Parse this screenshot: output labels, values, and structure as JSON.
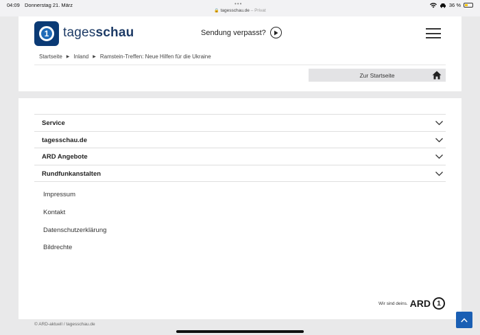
{
  "status_bar": {
    "time": "04:09",
    "date": "Donnerstag 21. März",
    "dots": "•••",
    "url": "tagesschau.de",
    "url_suffix": "– Privat",
    "battery": "36 %",
    "battery_level": 0.36
  },
  "header": {
    "brand_light": "tages",
    "brand_bold": "schau",
    "sendung_label": "Sendung verpasst?",
    "breadcrumbs": [
      "Startseite",
      "Inland",
      "Ramstein-Treffen: Neue Hilfen für die Ukraine"
    ],
    "home_button": "Zur Startseite"
  },
  "footer": {
    "accordion": [
      "Service",
      "tagesschau.de",
      "ARD Angebote",
      "Rundfunkanstalten"
    ],
    "links": [
      "Impressum",
      "Kontakt",
      "Datenschutzerklärung",
      "Bildrechte"
    ],
    "ard_tagline": "Wir sind deins.",
    "ard_logo": "ARD",
    "copyright": "© ARD-aktuell / tagesschau.de"
  },
  "colors": {
    "brand_blue": "#1d3b66",
    "logo_blue": "#0a3a75",
    "scroll_button": "#1a5fb4"
  }
}
